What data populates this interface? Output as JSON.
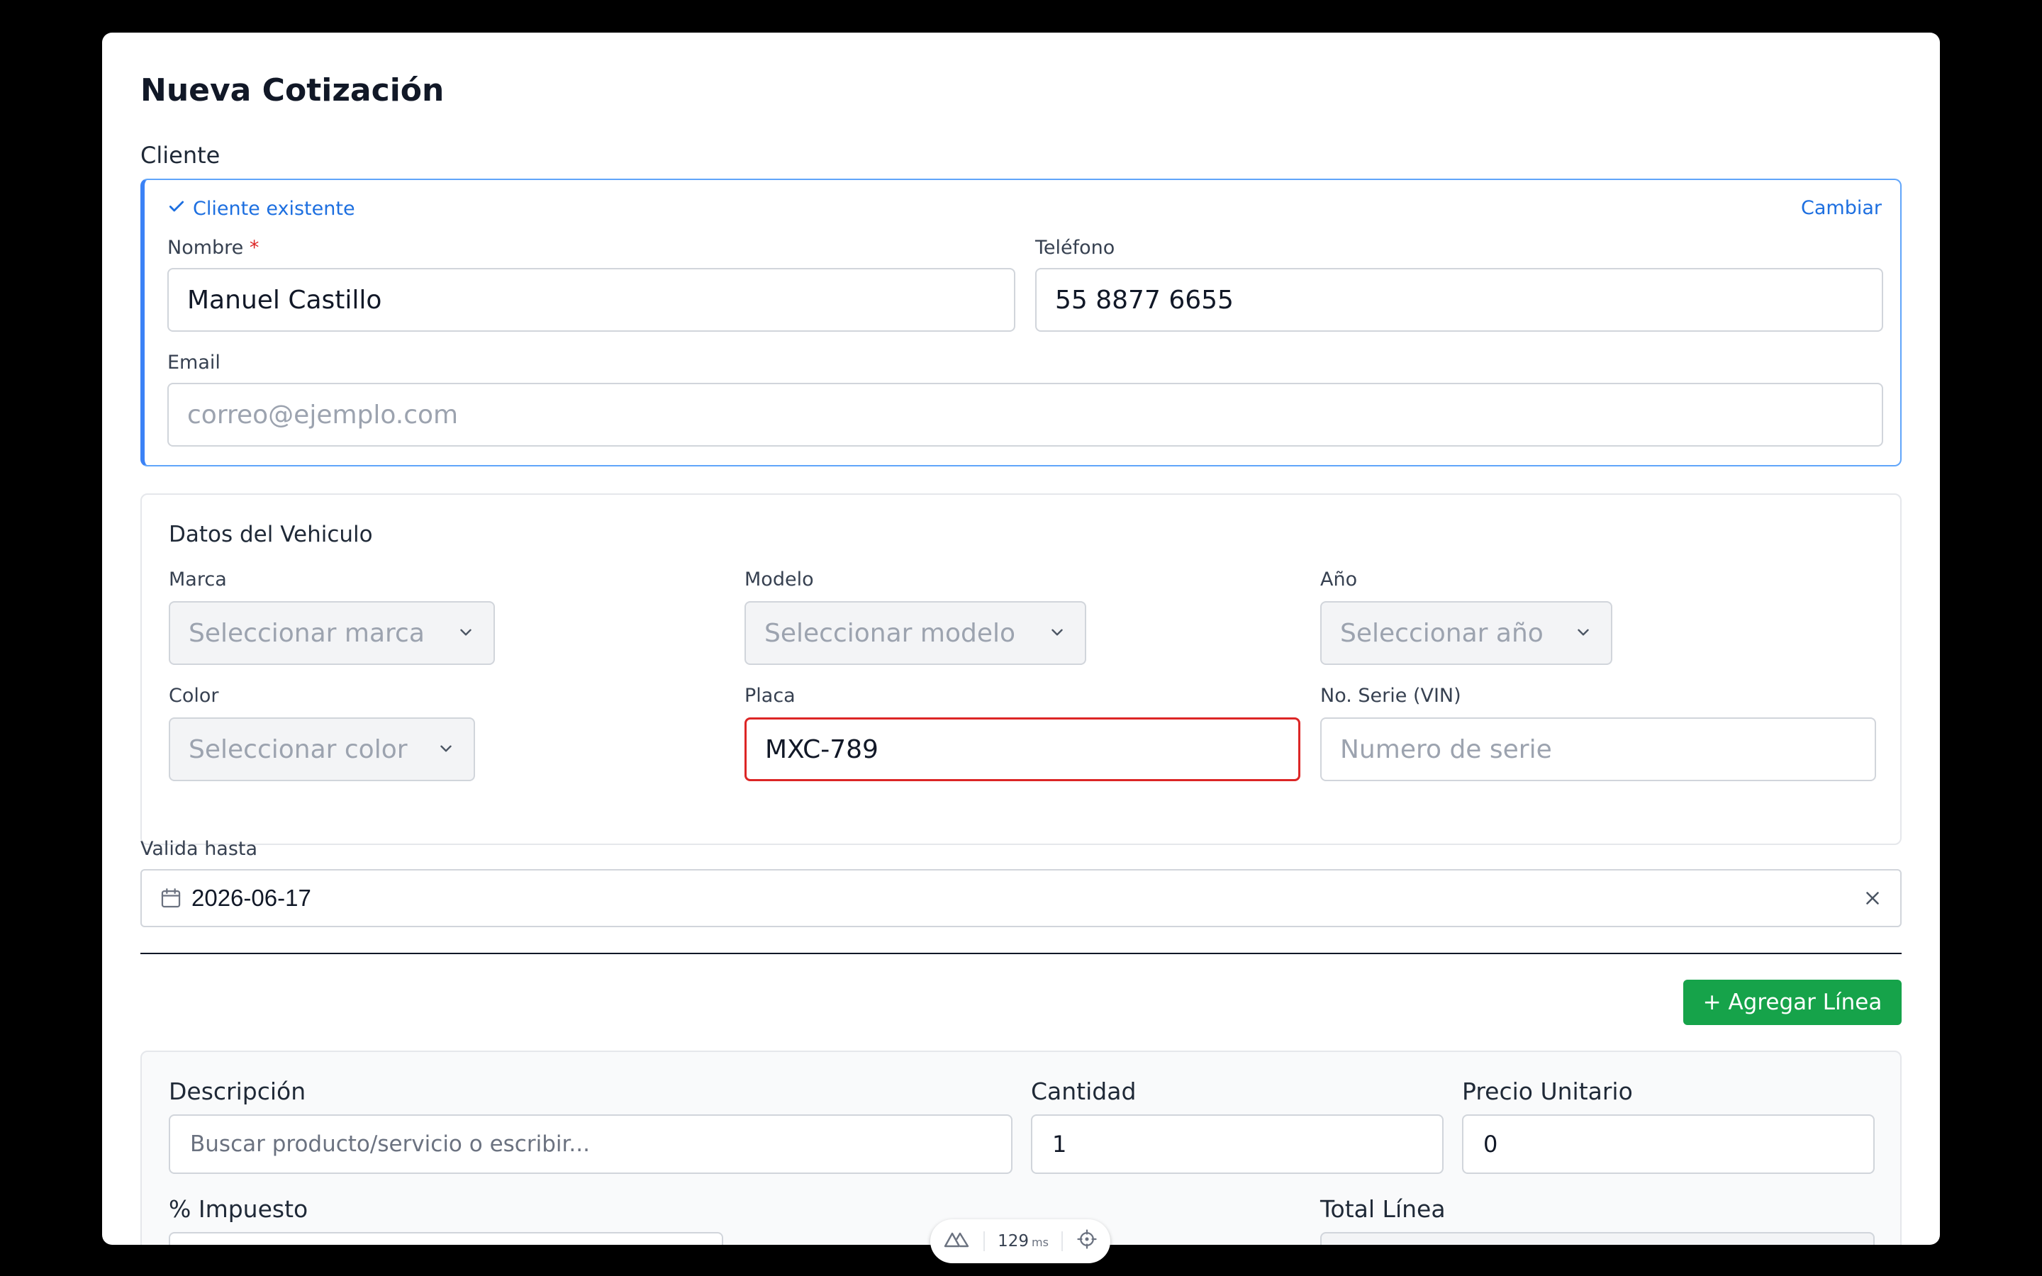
{
  "title": "Nueva Cotización",
  "client": {
    "section_label": "Cliente",
    "status_icon": "check-icon",
    "status": "Cliente existente",
    "change_link": "Cambiar",
    "name_label": "Nombre",
    "name_required": "*",
    "name_value": "Manuel Castillo",
    "phone_label": "Teléfono",
    "phone_value": "55 8877 6655",
    "email_label": "Email",
    "email_placeholder": "correo@ejemplo.com"
  },
  "vehicle": {
    "section_title": "Datos del Vehiculo",
    "brand_label": "Marca",
    "brand_placeholder": "Seleccionar marca",
    "model_label": "Modelo",
    "model_placeholder": "Seleccionar modelo",
    "year_label": "Año",
    "year_placeholder": "Seleccionar año",
    "color_label": "Color",
    "color_placeholder": "Seleccionar color",
    "plate_label": "Placa",
    "plate_value": "MXC-789",
    "vin_label": "No. Serie (VIN)",
    "vin_placeholder": "Numero de serie"
  },
  "validity": {
    "label": "Valida hasta",
    "value": "2026-06-17",
    "icon": "calendar-icon",
    "clear_icon": "close-icon"
  },
  "add_line_button": "+ Agregar Línea",
  "line": {
    "description_label": "Descripción",
    "description_placeholder": "Buscar producto/servicio o escribir...",
    "quantity_label": "Cantidad",
    "quantity_value": "1",
    "unit_price_label": "Precio Unitario",
    "unit_price_value": "0",
    "tax_label": "% Impuesto",
    "total_label": "Total Línea"
  },
  "devtools": {
    "time_value": "129",
    "time_unit": "ms"
  },
  "colors": {
    "background": "#000000",
    "primary": "#1d6fe0",
    "success": "#16a34a",
    "error": "#dc2626"
  }
}
